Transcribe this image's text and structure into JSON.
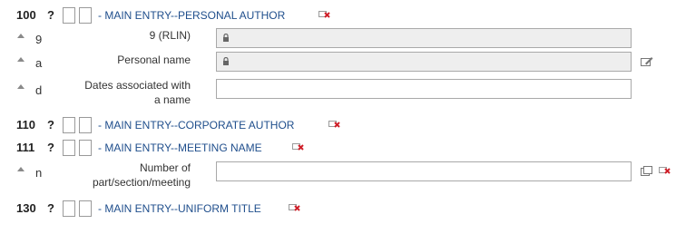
{
  "fields": {
    "f100": {
      "tag": "100",
      "help": "?",
      "description": "- MAIN ENTRY--PERSONAL AUTHOR"
    },
    "f110": {
      "tag": "110",
      "help": "?",
      "description": "- MAIN ENTRY--CORPORATE AUTHOR"
    },
    "f111": {
      "tag": "111",
      "help": "?",
      "description": "- MAIN ENTRY--MEETING NAME"
    },
    "f130": {
      "tag": "130",
      "help": "?",
      "description": "- MAIN ENTRY--UNIFORM TITLE"
    }
  },
  "subfields": {
    "s9": {
      "code": "9",
      "label": "9 (RLIN)",
      "value": "",
      "locked": true
    },
    "sa": {
      "code": "a",
      "label": "Personal name",
      "value": "",
      "locked": true
    },
    "sd": {
      "code": "d",
      "label_line1": "Dates associated with",
      "label_line2": "a name",
      "value": ""
    },
    "sn": {
      "code": "n",
      "label_line1": "Number of",
      "label_line2": "part/section/meeting",
      "value": ""
    }
  },
  "colors": {
    "link": "#1f4e8c",
    "delete": "#d0202a",
    "locked_bg": "#eeeeee"
  },
  "icons": [
    "lock-icon",
    "edit-icon",
    "clone-icon",
    "delete-icon",
    "move-up-arrow-icon"
  ]
}
